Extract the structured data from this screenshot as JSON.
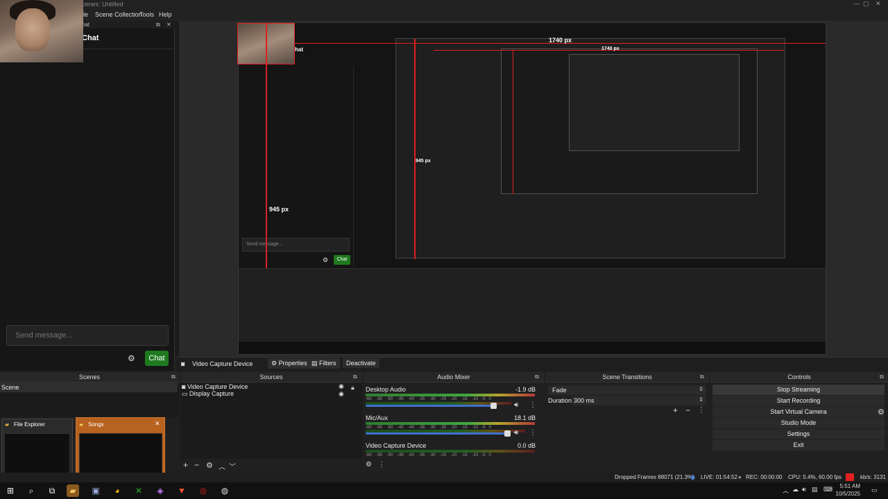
{
  "window": {
    "title": "cenes: Untitled"
  },
  "menu": {
    "file_partial": "ile",
    "scene_collection": "Scene Collection",
    "tools": "Tools",
    "help": "Help"
  },
  "chat": {
    "header_partial": "hat",
    "title_partial": "Chat",
    "placeholder": "Send message...",
    "send_label": "Chat"
  },
  "preview": {
    "measure_top": "1740 px",
    "measure_left": "945 px",
    "nested_measure_top": "1740 px",
    "nested_measure_left": "945 px",
    "nested_chat_title": "hat",
    "nested_send": "Send message...",
    "nested_chat_btn": "Chat",
    "nested_chat_btn_color": "#1f7a1f",
    "measure_color": "#e02020"
  },
  "source_bar": {
    "source_name": "Video Capture Device",
    "properties": "Properties",
    "filters": "Filters",
    "deactivate": "Deactivate"
  },
  "panels": {
    "scenes": "Scenes",
    "sources": "Sources",
    "audio_mixer": "Audio Mixer",
    "scene_transitions": "Scene Transitions",
    "controls": "Controls"
  },
  "scenes": {
    "items": [
      "Scene"
    ],
    "thumbnails": [
      {
        "title": "File Explorer"
      },
      {
        "title": "Songs"
      }
    ]
  },
  "sources": {
    "items": [
      {
        "name": "Video Capture Device",
        "icon": "camera-icon"
      },
      {
        "name": "Display Capture",
        "icon": "monitor-icon"
      }
    ]
  },
  "mixer": {
    "ticks": [
      "-60",
      "-55",
      "-50",
      "-45",
      "-40",
      "-35",
      "-30",
      "-25",
      "-20",
      "-15",
      "-10",
      "-5",
      "0"
    ],
    "channels": [
      {
        "name": "Desktop Audio",
        "db": "-1.9 dB",
        "level": 0.78
      },
      {
        "name": "Mic/Aux",
        "db": "18.1 dB",
        "level": 0.92
      },
      {
        "name": "Video Capture Device",
        "db": "0.0 dB",
        "level": 0.0
      }
    ]
  },
  "transitions": {
    "type": "Fade",
    "duration_label": "Duration",
    "duration_value": "300 ms"
  },
  "controls": {
    "stop_streaming": "Stop Streaming",
    "start_recording": "Start Recording",
    "start_virtual_camera": "Start Virtual Camera",
    "studio_mode": "Studio Mode",
    "settings": "Settings",
    "exit": "Exit"
  },
  "status": {
    "dropped_frames": "Dropped Frames 88071 (21.3%)",
    "live": "LIVE: 01:54:52",
    "rec": "REC: 00:00:00",
    "cpu": "CPU: 5.4%, 60.00 fps",
    "kbps": "kb/s: 3131"
  },
  "taskbar": {
    "time": "5:51 AM",
    "date": "10/5/2025"
  },
  "colors": {
    "live_indicator": "#e02020",
    "thumbnail_active": "#b8621f",
    "chat_button": "#1f7a1f",
    "slider": "#3f6fd1"
  }
}
